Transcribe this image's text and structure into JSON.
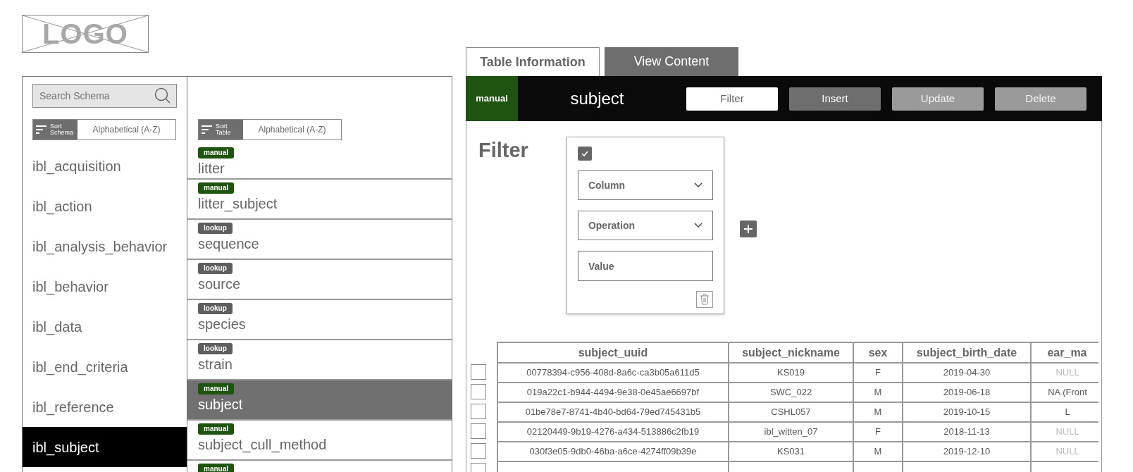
{
  "logo": {
    "text": "LOGO"
  },
  "schema_panel": {
    "search": {
      "placeholder": "Search Schema"
    },
    "sort": {
      "label": "Sort Schema",
      "value": "Alphabetical (A-Z)"
    },
    "items": [
      {
        "name": "ibl_acquisition",
        "selected": false
      },
      {
        "name": "ibl_action",
        "selected": false
      },
      {
        "name": "ibl_analysis_behavior",
        "selected": false
      },
      {
        "name": "ibl_behavior",
        "selected": false
      },
      {
        "name": "ibl_data",
        "selected": false
      },
      {
        "name": "ibl_end_criteria",
        "selected": false
      },
      {
        "name": "ibl_reference",
        "selected": false
      },
      {
        "name": "ibl_subject",
        "selected": true
      }
    ]
  },
  "table_panel": {
    "sort": {
      "label": "Sort Table",
      "value": "Alphabetical (A-Z)"
    },
    "items": [
      {
        "badge": "manual",
        "kind": "manual",
        "name": "litter",
        "selected": false
      },
      {
        "badge": "manual",
        "kind": "manual",
        "name": "litter_subject",
        "selected": false
      },
      {
        "badge": "lookup",
        "kind": "lookup",
        "name": "sequence",
        "selected": false
      },
      {
        "badge": "lookup",
        "kind": "lookup",
        "name": "source",
        "selected": false
      },
      {
        "badge": "lookup",
        "kind": "lookup",
        "name": "species",
        "selected": false
      },
      {
        "badge": "lookup",
        "kind": "lookup",
        "name": "strain",
        "selected": false
      },
      {
        "badge": "manual",
        "kind": "manual",
        "name": "subject",
        "selected": true
      },
      {
        "badge": "manual",
        "kind": "manual",
        "name": "subject_cull_method",
        "selected": false
      },
      {
        "badge": "manual",
        "kind": "manual",
        "selected": false
      }
    ]
  },
  "tabs": [
    {
      "label": "Table Information",
      "selected": true
    },
    {
      "label": "View Content",
      "selected": false
    }
  ],
  "header": {
    "tier": "manual",
    "title": "subject",
    "buttons": [
      {
        "label": "Filter",
        "selected": true,
        "disabled": false
      },
      {
        "label": "Insert",
        "selected": false,
        "disabled": false
      },
      {
        "label": "Update",
        "selected": false,
        "disabled": true
      },
      {
        "label": "Delete",
        "selected": false,
        "disabled": true
      }
    ]
  },
  "filter": {
    "title": "Filter",
    "card": {
      "checked": true,
      "column": {
        "placeholder": "Column"
      },
      "operation": {
        "placeholder": "Operation"
      },
      "value": {
        "placeholder": "Value"
      }
    }
  },
  "table": {
    "columns": [
      "subject_uuid",
      "subject_nickname",
      "sex",
      "subject_birth_date",
      "ear_ma"
    ],
    "rows": [
      {
        "checked": false,
        "cells": [
          "00778394-c956-408d-8a6c-ca3b05a611d5",
          "KS019",
          "F",
          "2019-04-30"
        ],
        "last": {
          "text": "NULL",
          "is_null": true
        }
      },
      {
        "checked": false,
        "cells": [
          "019a22c1-b944-4494-9e38-0e45ae6697bf",
          "SWC_022",
          "M",
          "2019-06-18"
        ],
        "last": {
          "text": "NA (Front",
          "is_null": false
        }
      },
      {
        "checked": false,
        "cells": [
          "01be78e7-8741-4b40-bd64-79ed745431b5",
          "CSHL057",
          "M",
          "2019-10-15"
        ],
        "last": {
          "text": "L",
          "is_null": false
        }
      },
      {
        "checked": false,
        "cells": [
          "02120449-9b19-4276-a434-513886c2fb19",
          "ibl_witten_07",
          "F",
          "2018-11-13"
        ],
        "last": {
          "text": "NULL",
          "is_null": true
        }
      },
      {
        "checked": false,
        "cells": [
          "030f3e05-9db0-46ba-a6ce-4274ff09b39e",
          "KS031",
          "M",
          "2019-12-10"
        ],
        "last": {
          "text": "NULL",
          "is_null": true
        }
      }
    ],
    "next_row": {
      "checked": false
    }
  }
}
